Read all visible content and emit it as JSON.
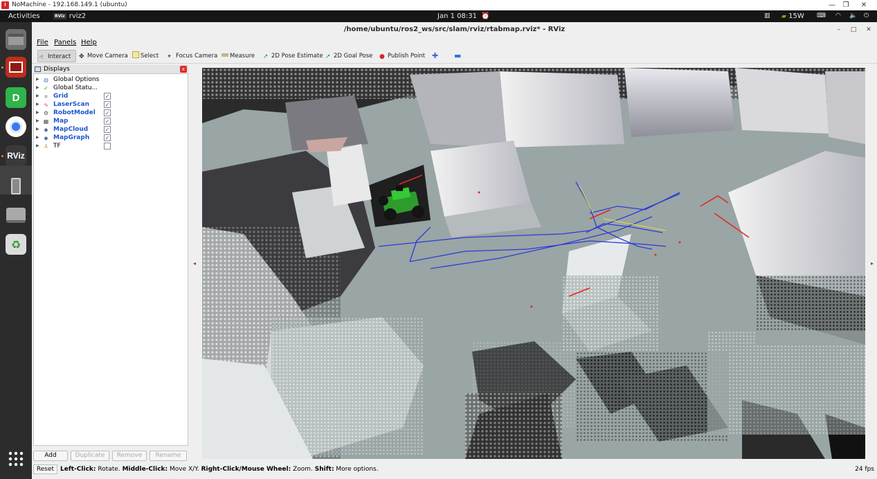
{
  "nomachine": {
    "title": "NoMachine - 192.168.149.1 (ubuntu)",
    "minimize": "—",
    "restore": "❐",
    "close": "✕"
  },
  "topbar": {
    "activities": "Activities",
    "app": "rviz2",
    "clock": "Jan 1  08:31",
    "power": "15W"
  },
  "rviz": {
    "title": "/home/ubuntu/ros2_ws/src/slam/rviz/rtabmap.rviz* - RViz",
    "menu": [
      "File",
      "Panels",
      "Help"
    ],
    "tools": [
      "Interact",
      "Move Camera",
      "Select",
      "Focus Camera",
      "Measure",
      "2D Pose Estimate",
      "2D Goal Pose",
      "Publish Point"
    ],
    "window_controls": {
      "min": "–",
      "max": "□",
      "close": "✕"
    }
  },
  "displays": {
    "title": "Displays",
    "items": [
      {
        "label": "Global Options",
        "icon": "globe-icon",
        "checked": null,
        "highlight": false
      },
      {
        "label": "Global Statu...",
        "icon": "check-icon",
        "checked": null,
        "highlight": false
      },
      {
        "label": "Grid",
        "icon": "grid-icon",
        "checked": true,
        "highlight": true
      },
      {
        "label": "LaserScan",
        "icon": "laserscan-icon",
        "checked": true,
        "highlight": true
      },
      {
        "label": "RobotModel",
        "icon": "robot-icon",
        "checked": true,
        "highlight": true
      },
      {
        "label": "Map",
        "icon": "map-icon",
        "checked": true,
        "highlight": true
      },
      {
        "label": "MapCloud",
        "icon": "cloud-icon",
        "checked": true,
        "highlight": true
      },
      {
        "label": "MapGraph",
        "icon": "graph-icon",
        "checked": true,
        "highlight": true
      },
      {
        "label": "TF",
        "icon": "tf-icon",
        "checked": false,
        "highlight": false
      }
    ],
    "buttons": {
      "add": "Add",
      "duplicate": "Duplicate",
      "remove": "Remove",
      "rename": "Rename"
    }
  },
  "status": {
    "reset": "Reset",
    "l1": "Left-Click:",
    "t1": " Rotate. ",
    "l2": "Middle-Click:",
    "t2": " Move X/Y. ",
    "l3": "Right-Click/Mouse Wheel:",
    "t3": " Zoom. ",
    "l4": "Shift:",
    "t4": " More options.",
    "fps": "24 fps"
  },
  "colors": {
    "floor": "#9aa5a5",
    "path": "#2b3bd8",
    "robot": "#23c023",
    "tf_red": "#e02828",
    "accent_blue": "#1e57c8"
  }
}
